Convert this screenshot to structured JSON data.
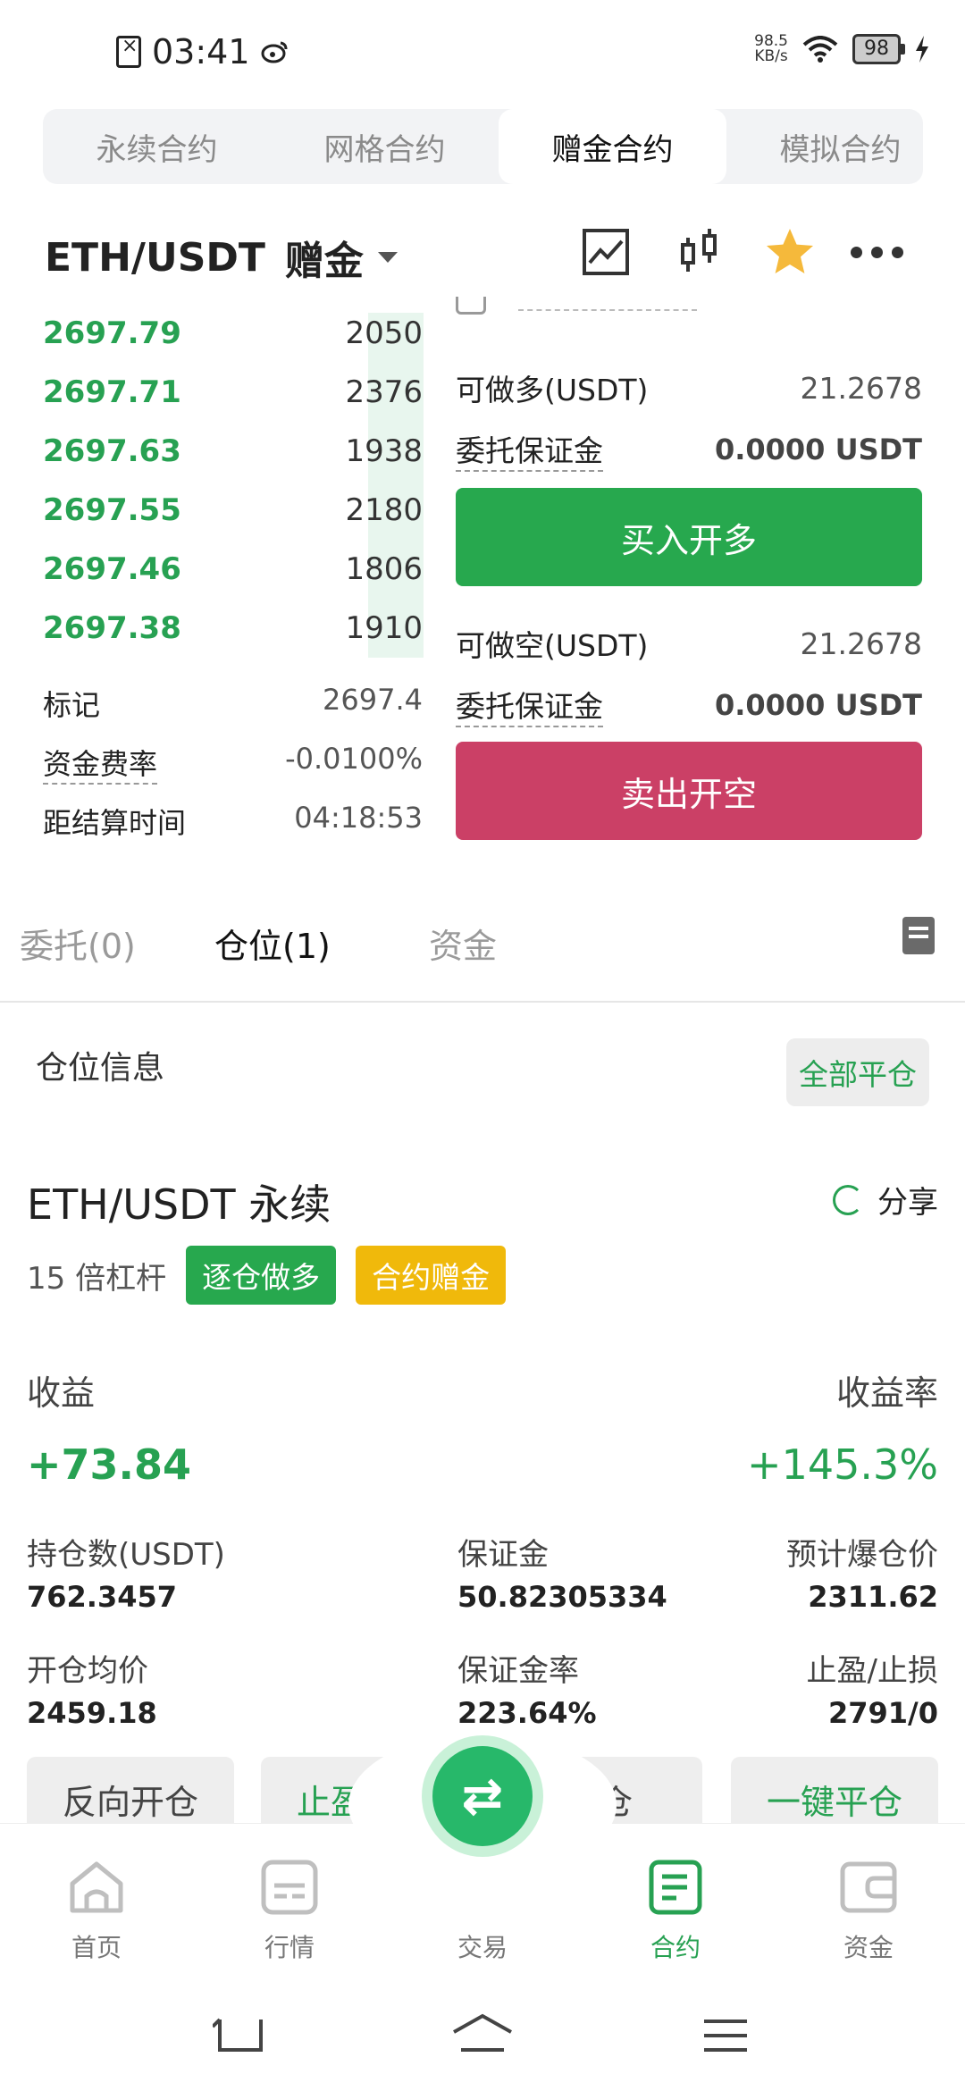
{
  "status_bar": {
    "time": "03:41",
    "net_speed_value": "98.5",
    "net_speed_unit": "KB/s",
    "battery": "98"
  },
  "top_tabs": [
    {
      "label": "永续合约",
      "active": false
    },
    {
      "label": "网格合约",
      "active": false
    },
    {
      "label": "赠金合约",
      "active": true
    },
    {
      "label": "模拟合约",
      "active": false
    }
  ],
  "header": {
    "pair": "ETH/USDT",
    "mode": "赠金",
    "icons": [
      "chart-line-icon",
      "candlestick-icon",
      "star-icon",
      "more-icon"
    ]
  },
  "order_book": [
    {
      "price": "2697.79",
      "qty": "2050"
    },
    {
      "price": "2697.71",
      "qty": "2376"
    },
    {
      "price": "2697.63",
      "qty": "1938"
    },
    {
      "price": "2697.55",
      "qty": "2180"
    },
    {
      "price": "2697.46",
      "qty": "1806"
    },
    {
      "price": "2697.38",
      "qty": "1910"
    }
  ],
  "market_info": {
    "mark_label": "标记",
    "mark_value": "2697.4",
    "funding_label": "资金费率",
    "funding_value": "-0.0100%",
    "settle_label": "距结算时间",
    "settle_value": "04:18:53"
  },
  "trade_panel": {
    "long_avail_label": "可做多(USDT)",
    "long_avail_value": "21.2678",
    "margin_label": "委托保证金",
    "margin_value": "0.0000 USDT",
    "buy_button": "买入开多",
    "short_avail_label": "可做空(USDT)",
    "short_avail_value": "21.2678",
    "short_margin_label": "委托保证金",
    "short_margin_value": "0.0000 USDT",
    "sell_button": "卖出开空"
  },
  "position_tabs": [
    {
      "label": "委托(0)",
      "active": false
    },
    {
      "label": "仓位(1)",
      "active": true
    },
    {
      "label": "资金",
      "active": false
    }
  ],
  "position_section": {
    "title": "仓位信息",
    "close_all": "全部平仓"
  },
  "position": {
    "name": "ETH/USDT 永续",
    "share": "分享",
    "leverage": "15 倍杠杆",
    "tag_side": "逐仓做多",
    "tag_type": "合约赠金",
    "pnl_label": "收益",
    "pnl_value": "+73.84",
    "rate_label": "收益率",
    "rate_value": "+145.3%",
    "size_label": "持仓数(USDT)",
    "size_value": "762.3457",
    "margin_label": "保证金",
    "margin_value": "50.82305334",
    "liq_label": "预计爆仓价",
    "liq_value": "2311.62",
    "entry_label": "开仓均价",
    "entry_value": "2459.18",
    "margin_rate_label": "保证金率",
    "margin_rate_value": "223.64%",
    "tpsl_label": "止盈/止损",
    "tpsl_value": "2791/0"
  },
  "actions": [
    "反向开仓",
    "止盈止损",
    "平仓",
    "一键平仓"
  ],
  "bottom_nav": [
    {
      "label": "首页",
      "icon": "home-icon",
      "active": false
    },
    {
      "label": "行情",
      "icon": "market-icon",
      "active": false
    },
    {
      "label": "交易",
      "icon": "swap-icon",
      "active": false
    },
    {
      "label": "合约",
      "icon": "contract-icon",
      "active": true
    },
    {
      "label": "资金",
      "icon": "wallet-icon",
      "active": false
    }
  ],
  "colors": {
    "green": "#27a84e",
    "red": "#cb4066",
    "gold": "#f0b90b"
  }
}
